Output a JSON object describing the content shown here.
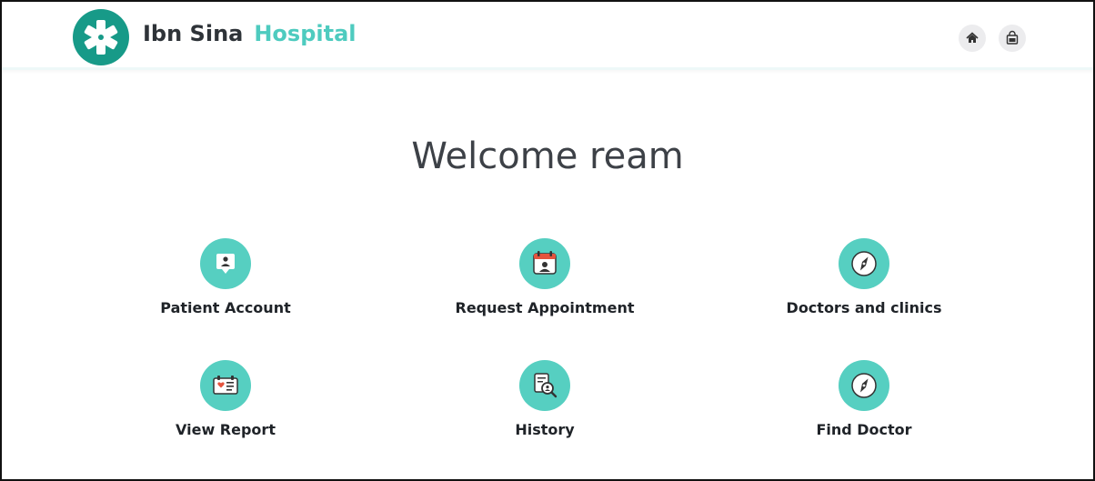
{
  "header": {
    "brand_name": "Ibn Sina",
    "brand_accent": "Hospital",
    "logo_icon": "medical-star-icon",
    "buttons": [
      {
        "name": "home-button",
        "icon": "home-icon"
      },
      {
        "name": "shop-button",
        "icon": "shopping-bag-icon"
      }
    ]
  },
  "main": {
    "welcome": "Welcome ream",
    "tiles": [
      {
        "label": "Patient Account",
        "icon": "patient-account-icon"
      },
      {
        "label": "Request Appointment",
        "icon": "calendar-appointment-icon"
      },
      {
        "label": "Doctors and clinics",
        "icon": "compass-icon"
      },
      {
        "label": "View Report",
        "icon": "report-card-icon"
      },
      {
        "label": "History",
        "icon": "document-search-icon"
      },
      {
        "label": "Find Doctor",
        "icon": "compass-icon"
      }
    ]
  },
  "colors": {
    "brand_dark": "#179a88",
    "accent": "#4ecbbf",
    "tile_circle": "#56cfc1",
    "text": "#1f2328",
    "welcome_text": "#3d4147",
    "header_button_bg": "#ececee"
  }
}
